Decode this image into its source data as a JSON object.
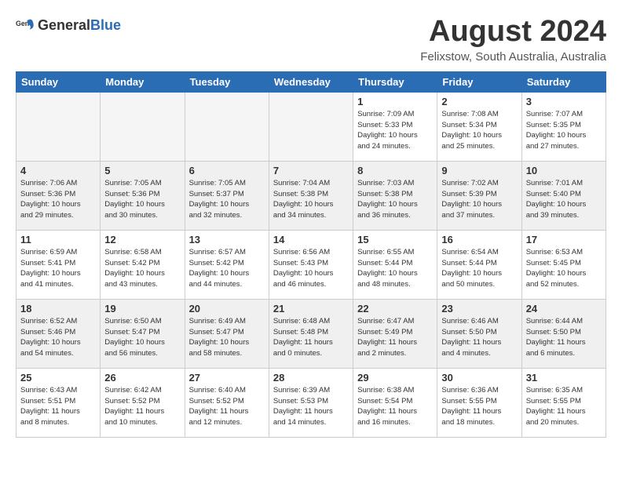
{
  "header": {
    "logo_general": "General",
    "logo_blue": "Blue",
    "title": "August 2024",
    "location": "Felixstow, South Australia, Australia"
  },
  "weekdays": [
    "Sunday",
    "Monday",
    "Tuesday",
    "Wednesday",
    "Thursday",
    "Friday",
    "Saturday"
  ],
  "weeks": [
    [
      {
        "day": "",
        "info": ""
      },
      {
        "day": "",
        "info": ""
      },
      {
        "day": "",
        "info": ""
      },
      {
        "day": "",
        "info": ""
      },
      {
        "day": "1",
        "info": "Sunrise: 7:09 AM\nSunset: 5:33 PM\nDaylight: 10 hours\nand 24 minutes."
      },
      {
        "day": "2",
        "info": "Sunrise: 7:08 AM\nSunset: 5:34 PM\nDaylight: 10 hours\nand 25 minutes."
      },
      {
        "day": "3",
        "info": "Sunrise: 7:07 AM\nSunset: 5:35 PM\nDaylight: 10 hours\nand 27 minutes."
      }
    ],
    [
      {
        "day": "4",
        "info": "Sunrise: 7:06 AM\nSunset: 5:36 PM\nDaylight: 10 hours\nand 29 minutes."
      },
      {
        "day": "5",
        "info": "Sunrise: 7:05 AM\nSunset: 5:36 PM\nDaylight: 10 hours\nand 30 minutes."
      },
      {
        "day": "6",
        "info": "Sunrise: 7:05 AM\nSunset: 5:37 PM\nDaylight: 10 hours\nand 32 minutes."
      },
      {
        "day": "7",
        "info": "Sunrise: 7:04 AM\nSunset: 5:38 PM\nDaylight: 10 hours\nand 34 minutes."
      },
      {
        "day": "8",
        "info": "Sunrise: 7:03 AM\nSunset: 5:38 PM\nDaylight: 10 hours\nand 36 minutes."
      },
      {
        "day": "9",
        "info": "Sunrise: 7:02 AM\nSunset: 5:39 PM\nDaylight: 10 hours\nand 37 minutes."
      },
      {
        "day": "10",
        "info": "Sunrise: 7:01 AM\nSunset: 5:40 PM\nDaylight: 10 hours\nand 39 minutes."
      }
    ],
    [
      {
        "day": "11",
        "info": "Sunrise: 6:59 AM\nSunset: 5:41 PM\nDaylight: 10 hours\nand 41 minutes."
      },
      {
        "day": "12",
        "info": "Sunrise: 6:58 AM\nSunset: 5:42 PM\nDaylight: 10 hours\nand 43 minutes."
      },
      {
        "day": "13",
        "info": "Sunrise: 6:57 AM\nSunset: 5:42 PM\nDaylight: 10 hours\nand 44 minutes."
      },
      {
        "day": "14",
        "info": "Sunrise: 6:56 AM\nSunset: 5:43 PM\nDaylight: 10 hours\nand 46 minutes."
      },
      {
        "day": "15",
        "info": "Sunrise: 6:55 AM\nSunset: 5:44 PM\nDaylight: 10 hours\nand 48 minutes."
      },
      {
        "day": "16",
        "info": "Sunrise: 6:54 AM\nSunset: 5:44 PM\nDaylight: 10 hours\nand 50 minutes."
      },
      {
        "day": "17",
        "info": "Sunrise: 6:53 AM\nSunset: 5:45 PM\nDaylight: 10 hours\nand 52 minutes."
      }
    ],
    [
      {
        "day": "18",
        "info": "Sunrise: 6:52 AM\nSunset: 5:46 PM\nDaylight: 10 hours\nand 54 minutes."
      },
      {
        "day": "19",
        "info": "Sunrise: 6:50 AM\nSunset: 5:47 PM\nDaylight: 10 hours\nand 56 minutes."
      },
      {
        "day": "20",
        "info": "Sunrise: 6:49 AM\nSunset: 5:47 PM\nDaylight: 10 hours\nand 58 minutes."
      },
      {
        "day": "21",
        "info": "Sunrise: 6:48 AM\nSunset: 5:48 PM\nDaylight: 11 hours\nand 0 minutes."
      },
      {
        "day": "22",
        "info": "Sunrise: 6:47 AM\nSunset: 5:49 PM\nDaylight: 11 hours\nand 2 minutes."
      },
      {
        "day": "23",
        "info": "Sunrise: 6:46 AM\nSunset: 5:50 PM\nDaylight: 11 hours\nand 4 minutes."
      },
      {
        "day": "24",
        "info": "Sunrise: 6:44 AM\nSunset: 5:50 PM\nDaylight: 11 hours\nand 6 minutes."
      }
    ],
    [
      {
        "day": "25",
        "info": "Sunrise: 6:43 AM\nSunset: 5:51 PM\nDaylight: 11 hours\nand 8 minutes."
      },
      {
        "day": "26",
        "info": "Sunrise: 6:42 AM\nSunset: 5:52 PM\nDaylight: 11 hours\nand 10 minutes."
      },
      {
        "day": "27",
        "info": "Sunrise: 6:40 AM\nSunset: 5:52 PM\nDaylight: 11 hours\nand 12 minutes."
      },
      {
        "day": "28",
        "info": "Sunrise: 6:39 AM\nSunset: 5:53 PM\nDaylight: 11 hours\nand 14 minutes."
      },
      {
        "day": "29",
        "info": "Sunrise: 6:38 AM\nSunset: 5:54 PM\nDaylight: 11 hours\nand 16 minutes."
      },
      {
        "day": "30",
        "info": "Sunrise: 6:36 AM\nSunset: 5:55 PM\nDaylight: 11 hours\nand 18 minutes."
      },
      {
        "day": "31",
        "info": "Sunrise: 6:35 AM\nSunset: 5:55 PM\nDaylight: 11 hours\nand 20 minutes."
      }
    ]
  ]
}
